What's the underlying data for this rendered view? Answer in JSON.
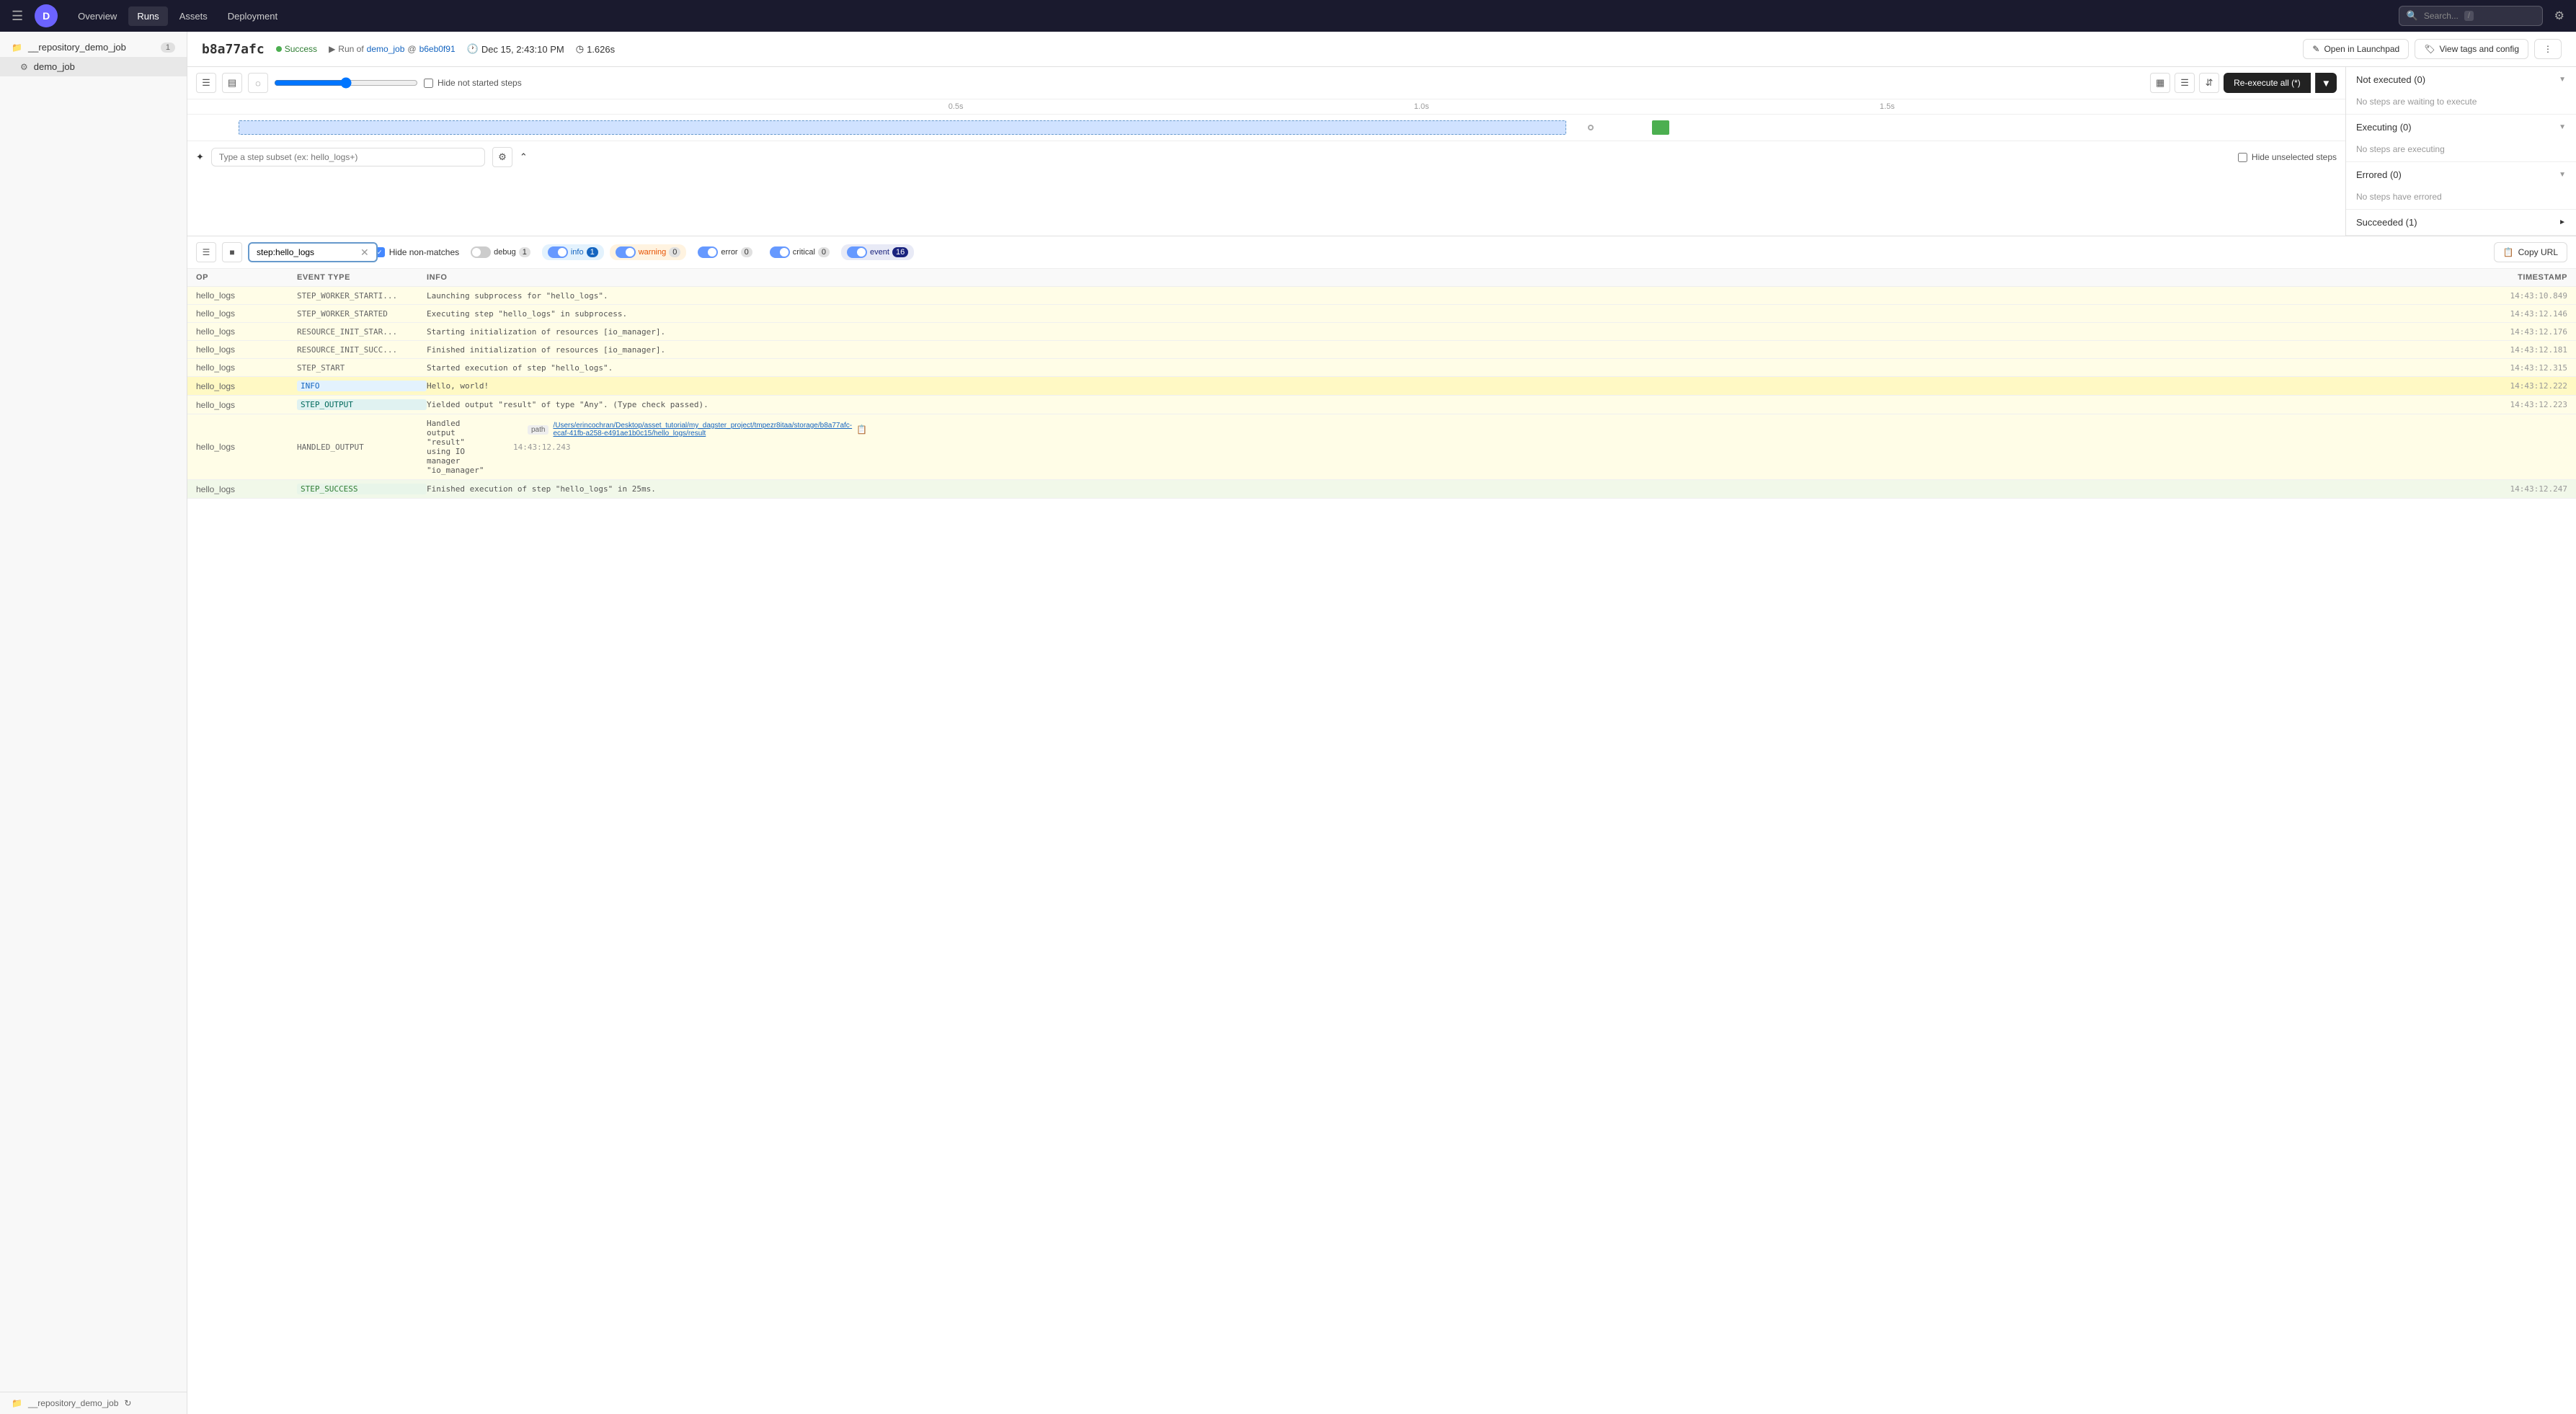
{
  "nav": {
    "links": [
      "Overview",
      "Runs",
      "Assets",
      "Deployment"
    ],
    "active_link": "Runs",
    "search_placeholder": "Search...",
    "search_shortcut": "/"
  },
  "sidebar": {
    "items": [
      {
        "icon": "📁",
        "label": "__repository_demo_job",
        "badge": "1",
        "type": "repo"
      },
      {
        "icon": "⚙",
        "label": "demo_job",
        "badge": "",
        "type": "job"
      }
    ],
    "footer_label": "__repository_demo_job",
    "footer_icon": "📁"
  },
  "run": {
    "id": "b8a77afc",
    "status": "Success",
    "run_of": "demo_job",
    "commit": "b6eb0f91",
    "date": "Dec 15, 2:43:10 PM",
    "duration": "1.626s",
    "btn_launchpad": "Open in Launchpad",
    "btn_tags": "View tags and config",
    "btn_reexecute": "Re-execute all (*)"
  },
  "timeline": {
    "hide_not_started_label": "Hide not started steps",
    "ticks": [
      "0.5s",
      "1.0s",
      "1.5s"
    ],
    "step_filter_placeholder": "Type a step subset (ex: hello_logs+)",
    "hide_unselected_label": "Hide unselected steps"
  },
  "status_panel": {
    "sections": [
      {
        "title": "Not executed (0)",
        "empty_msg": "No steps are waiting to execute"
      },
      {
        "title": "Executing (0)",
        "empty_msg": "No steps are executing"
      },
      {
        "title": "Errored (0)",
        "empty_msg": "No steps have errored"
      },
      {
        "title": "Succeeded (1)",
        "empty_msg": ""
      }
    ]
  },
  "logs": {
    "filter_value": "step:hello_logs",
    "hide_non_matches_label": "Hide non-matches",
    "hide_non_matches_checked": true,
    "levels": [
      {
        "name": "debug",
        "count": 1,
        "on": false,
        "color": "#888"
      },
      {
        "name": "info",
        "count": 1,
        "on": true,
        "color": "#1565c0"
      },
      {
        "name": "warning",
        "count": 0,
        "on": true,
        "color": "#e65100"
      },
      {
        "name": "error",
        "count": 0,
        "on": true,
        "color": "#b71c1c"
      },
      {
        "name": "critical",
        "count": 0,
        "on": true,
        "color": "#4a148c"
      },
      {
        "name": "event",
        "count": 16,
        "on": true,
        "color": "#1a237e"
      }
    ],
    "copy_url_label": "Copy URL",
    "columns": {
      "op": "OP",
      "event_type": "EVENT TYPE",
      "info": "INFO",
      "timestamp": "TIMESTAMP"
    },
    "rows": [
      {
        "op": "hello_logs",
        "event_type": "STEP_WORKER_STARTI...",
        "event_style": "default",
        "info": "Launching subprocess for \"hello_logs\".",
        "timestamp": "14:43:10.849",
        "highlight": "yellow"
      },
      {
        "op": "hello_logs",
        "event_type": "STEP_WORKER_STARTED",
        "event_style": "default",
        "info": "Executing step \"hello_logs\" in subprocess.",
        "timestamp": "14:43:12.146",
        "highlight": "yellow"
      },
      {
        "op": "hello_logs",
        "event_type": "RESOURCE_INIT_STAR...",
        "event_style": "default",
        "info": "Starting initialization of resources [io_manager].",
        "timestamp": "14:43:12.176",
        "highlight": "yellow"
      },
      {
        "op": "hello_logs",
        "event_type": "RESOURCE_INIT_SUCC...",
        "event_style": "default",
        "info": "Finished initialization of resources [io_manager].",
        "timestamp": "14:43:12.181",
        "highlight": "yellow"
      },
      {
        "op": "hello_logs",
        "event_type": "STEP_START",
        "event_style": "default",
        "info": "Started execution of step \"hello_logs\".",
        "timestamp": "14:43:12.315",
        "highlight": "yellow"
      },
      {
        "op": "hello_logs",
        "event_type": "INFO",
        "event_style": "info",
        "info": "Hello, world!",
        "timestamp": "14:43:12.222",
        "highlight": "yellow"
      },
      {
        "op": "hello_logs",
        "event_type": "STEP_OUTPUT",
        "event_style": "output",
        "info": "Yielded output \"result\" of type \"Any\". (Type check passed).",
        "timestamp": "14:43:12.223",
        "highlight": "yellow"
      },
      {
        "op": "hello_logs",
        "event_type": "HANDLED_OUTPUT",
        "event_style": "default",
        "info": "Handled output \"result\" using IO manager \"io_manager\"",
        "timestamp": "14:43:12.243",
        "highlight": "yellow",
        "has_path": true,
        "path_value": "/Users/erincochran/Desktop/asset_tutorial/my_dagster_project/tmpezr8itaa/storage/b8a77afc-ecaf-41fb-a258-e491ae1b0c15/hello_logs/result"
      },
      {
        "op": "hello_logs",
        "event_type": "STEP_SUCCESS",
        "event_style": "success",
        "info": "Finished execution of step \"hello_logs\" in 25ms.",
        "timestamp": "14:43:12.247",
        "highlight": "yellow"
      }
    ]
  }
}
